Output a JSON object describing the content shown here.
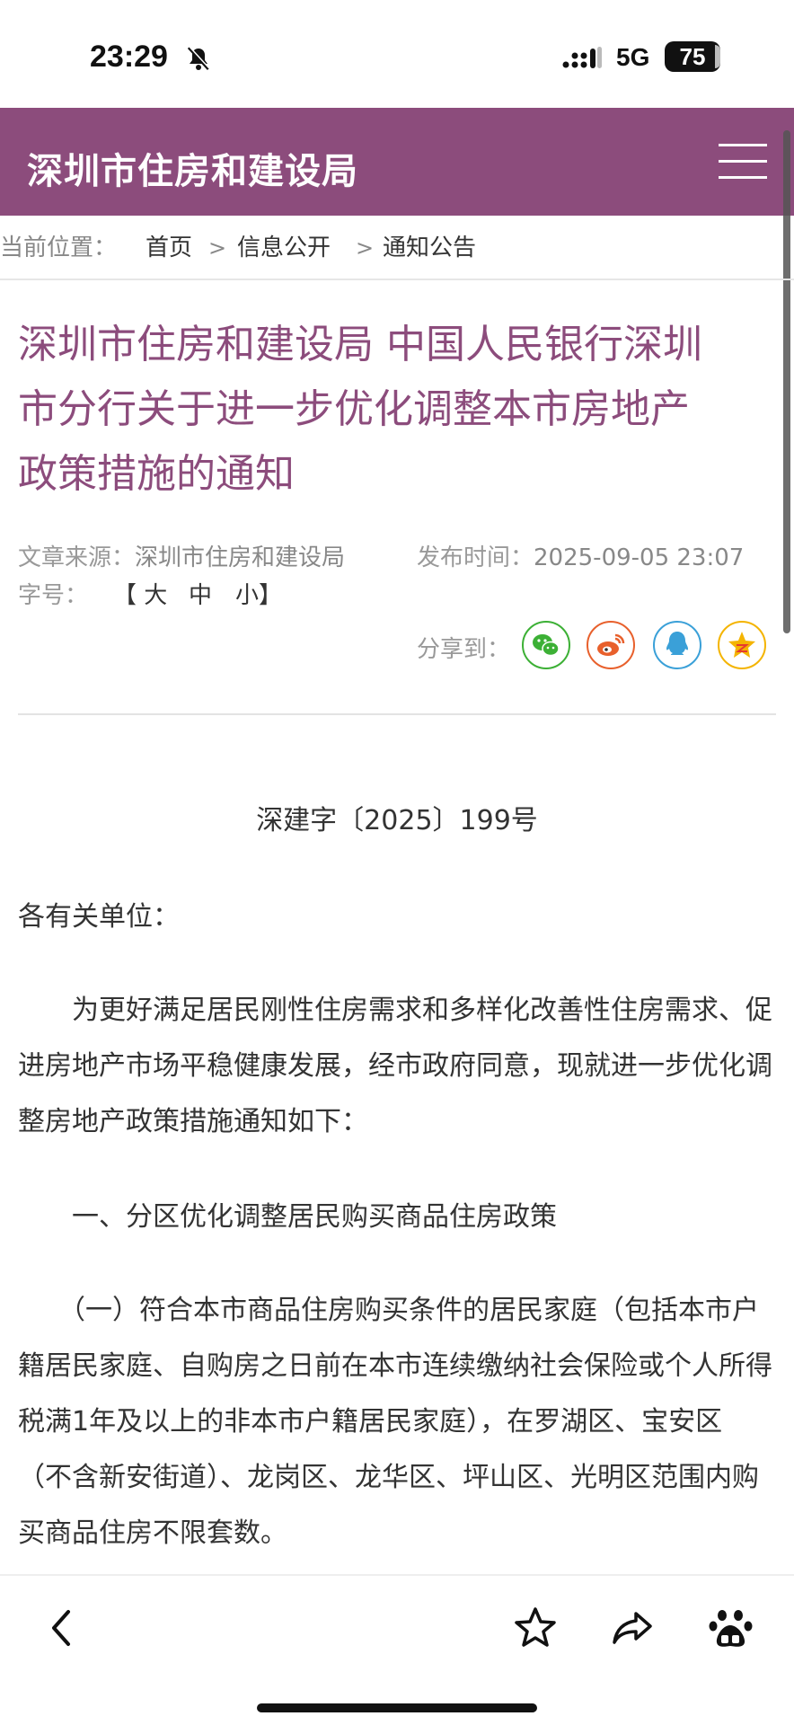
{
  "status_bar": {
    "time": "23:29",
    "network": "5G",
    "battery": "75"
  },
  "header": {
    "title": "深圳市住房和建设局"
  },
  "breadcrumb": {
    "prefix": "当前位置：",
    "items": [
      "首页",
      "信息公开",
      "通知公告"
    ],
    "separator": ">"
  },
  "article": {
    "title_lines": [
      "深圳市住房和建设局 中国人民银行深圳",
      "市分行关于进一步优化调整本市房地产",
      "政策措施的通知"
    ],
    "source_label": "文章来源：",
    "source": "深圳市住房和建设局",
    "time_label": "发布时间：",
    "publish_time": "2025-09-05 23:07",
    "font_size_label": "字号：",
    "font_size_options": [
      "【 大",
      "中",
      "小】"
    ],
    "share_label": "分享到："
  },
  "share_icons": [
    "wechat-icon",
    "weibo-icon",
    "qq-icon",
    "qzone-icon"
  ],
  "body": {
    "doc_number": "深建字〔2025〕199号",
    "salutation": "各有关单位：",
    "para1": "　　为更好满足居民刚性住房需求和多样化改善性住房需求、促进房地产市场平稳健康发展，经市政府同意，现就进一步优化调整房地产政策措施通知如下：",
    "section1": "　　一、分区优化调整居民购买商品住房政策",
    "para2": "　　（一）符合本市商品住房购买条件的居民家庭（包括本市户籍居民家庭、自购房之日前在本市连续缴纳社会保险或个人所得税满1年及以上的非本市户籍居民家庭），在罗湖区、宝安区（不含新安街道）、龙岗区、龙华区、坪山区、光明区范围内购买商品住房不限套数。"
  },
  "colors": {
    "brand": "#8c4c7c",
    "wechat": "#3cb035",
    "weibo": "#e8602c",
    "qq": "#3aa0d8",
    "qzone": "#f4b400"
  }
}
